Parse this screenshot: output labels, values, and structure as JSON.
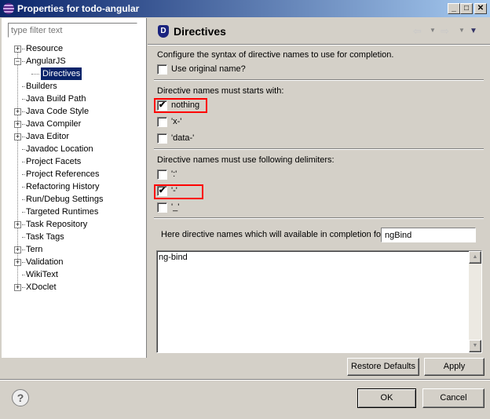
{
  "window": {
    "title": "Properties for todo-angular",
    "minimize": "_",
    "maximize": "□",
    "close": "✕"
  },
  "sidebar": {
    "filter_placeholder": "type filter text",
    "items": [
      {
        "label": "Resource",
        "expander": "+",
        "level": 0
      },
      {
        "label": "AngularJS",
        "expander": "−",
        "level": 0
      },
      {
        "label": "Directives",
        "level": 1,
        "selected": true
      },
      {
        "label": "Builders",
        "level": 0
      },
      {
        "label": "Java Build Path",
        "level": 0
      },
      {
        "label": "Java Code Style",
        "expander": "+",
        "level": 0
      },
      {
        "label": "Java Compiler",
        "expander": "+",
        "level": 0
      },
      {
        "label": "Java Editor",
        "expander": "+",
        "level": 0
      },
      {
        "label": "Javadoc Location",
        "level": 0
      },
      {
        "label": "Project Facets",
        "level": 0
      },
      {
        "label": "Project References",
        "level": 0
      },
      {
        "label": "Refactoring History",
        "level": 0
      },
      {
        "label": "Run/Debug Settings",
        "level": 0
      },
      {
        "label": "Targeted Runtimes",
        "level": 0
      },
      {
        "label": "Task Repository",
        "expander": "+",
        "level": 0
      },
      {
        "label": "Task Tags",
        "level": 0
      },
      {
        "label": "Tern",
        "expander": "+",
        "level": 0
      },
      {
        "label": "Validation",
        "expander": "+",
        "level": 0
      },
      {
        "label": "WikiText",
        "level": 0
      },
      {
        "label": "XDoclet",
        "expander": "+",
        "level": 0
      }
    ]
  },
  "page": {
    "icon_letter": "D",
    "title": "Directives",
    "description": "Configure the syntax of directive names to use for completion.",
    "use_original": {
      "label": "Use original name?",
      "checked": false
    },
    "starts_label": "Directive names must starts with:",
    "starts_options": [
      {
        "label": "nothing",
        "checked": true
      },
      {
        "label": "'x-'",
        "checked": false
      },
      {
        "label": "'data-'",
        "checked": false
      }
    ],
    "delim_label": "Directive names must use following delimiters:",
    "delim_options": [
      {
        "label": "':'",
        "checked": false
      },
      {
        "label": "'-'",
        "checked": true
      },
      {
        "label": "'_'",
        "checked": false
      }
    ],
    "completion_label": "Here directive names which will available in completion for",
    "completion_value": "ngBind",
    "result_text": "ng-bind",
    "restore_defaults": "Restore Defaults",
    "apply": "Apply"
  },
  "footer": {
    "help": "?",
    "ok": "OK",
    "cancel": "Cancel"
  }
}
